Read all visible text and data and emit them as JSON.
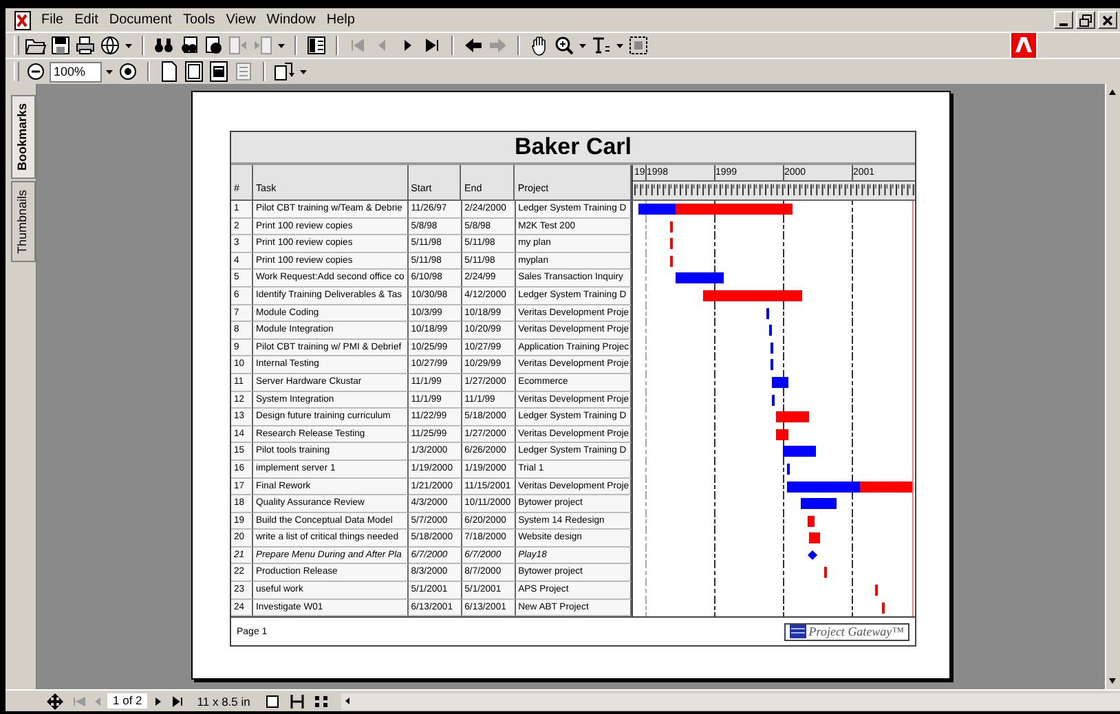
{
  "menu": [
    "File",
    "Edit",
    "Document",
    "Tools",
    "View",
    "Window",
    "Help"
  ],
  "toolbar": {
    "zoom_value": "100%"
  },
  "side_tabs": [
    {
      "label": "Bookmarks",
      "selected": true
    },
    {
      "label": "Thumbnails",
      "selected": false
    }
  ],
  "report": {
    "title": "Baker Carl",
    "columns": [
      "#",
      "Task",
      "Start",
      "End",
      "Project"
    ],
    "years": [
      "19",
      "1998",
      "1999",
      "2000",
      "2001"
    ],
    "tasks": [
      {
        "num": "1",
        "task": "Pilot CBT training w/Team & Debrie",
        "start": "11/26/97",
        "end": "2/24/2000",
        "project": "Ledger System Training D",
        "kind": "split",
        "level": 0.24
      },
      {
        "num": "2",
        "task": "Print 100 review copies",
        "start": "5/8/98",
        "end": "5/8/98",
        "project": "M2K Test 200",
        "kind": "bar",
        "color": "#ff0000"
      },
      {
        "num": "3",
        "task": "Print 100 review copies",
        "start": "5/11/98",
        "end": "5/11/98",
        "project": "my plan",
        "kind": "bar",
        "color": "#ff0000"
      },
      {
        "num": "4",
        "task": "Print 100 review copies",
        "start": "5/11/98",
        "end": "5/11/98",
        "project": "myplan",
        "kind": "bar",
        "color": "#ff0000"
      },
      {
        "num": "5",
        "task": "Work Request:Add second office co",
        "start": "6/10/98",
        "end": "2/24/99",
        "project": "Sales Transaction Inquiry",
        "kind": "bar",
        "color": "#0000ff"
      },
      {
        "num": "6",
        "task": "Identify Training Deliverables & Tas",
        "start": "10/30/98",
        "end": "4/12/2000",
        "project": "Ledger System Training D",
        "kind": "bar",
        "color": "#ff0000"
      },
      {
        "num": "7",
        "task": "Module Coding",
        "start": "10/3/99",
        "end": "10/18/99",
        "project": "Veritas Development Proje",
        "kind": "bar",
        "color": "#0000ff"
      },
      {
        "num": "8",
        "task": "Module Integration",
        "start": "10/18/99",
        "end": "10/20/99",
        "project": "Veritas Development Proje",
        "kind": "bar",
        "color": "#0000ff"
      },
      {
        "num": "9",
        "task": "Pilot CBT training w/ PMI & Debrief",
        "start": "10/25/99",
        "end": "10/27/99",
        "project": "Application Training Projec",
        "kind": "bar",
        "color": "#0000ff"
      },
      {
        "num": "10",
        "task": "Internal Testing",
        "start": "10/27/99",
        "end": "10/29/99",
        "project": "Veritas Development Proje",
        "kind": "bar",
        "color": "#0000ff"
      },
      {
        "num": "11",
        "task": "Server Hardware Ckustar",
        "start": "11/1/99",
        "end": "1/27/2000",
        "project": "Ecommerce",
        "kind": "bar",
        "color": "#0000ff"
      },
      {
        "num": "12",
        "task": "System Integration",
        "start": "11/1/99",
        "end": "11/1/99",
        "project": "Veritas Development Proje",
        "kind": "bar",
        "color": "#0000ff"
      },
      {
        "num": "13",
        "task": "Design future training curriculum",
        "start": "11/22/99",
        "end": "5/18/2000",
        "project": "Ledger System Training D",
        "kind": "bar",
        "color": "#ff0000"
      },
      {
        "num": "14",
        "task": "Research Release Testing",
        "start": "11/25/99",
        "end": "1/27/2000",
        "project": "Veritas Development Proje",
        "kind": "bar",
        "color": "#ff0000"
      },
      {
        "num": "15",
        "task": "Pilot tools training",
        "start": "1/3/2000",
        "end": "6/26/2000",
        "project": "Ledger System Training D",
        "kind": "bar",
        "color": "#0000ff"
      },
      {
        "num": "16",
        "task": "implement server 1",
        "start": "1/19/2000",
        "end": "1/19/2000",
        "project": "Trial 1",
        "kind": "bar",
        "color": "#0000ff"
      },
      {
        "num": "17",
        "task": "Final Rework",
        "start": "1/21/2000",
        "end": "11/15/2001",
        "project": "Veritas Development Proje",
        "kind": "split",
        "level": 0.59
      },
      {
        "num": "18",
        "task": "Quality Assurance Review",
        "start": "4/3/2000",
        "end": "10/11/2000",
        "project": "Bytower project",
        "kind": "bar",
        "color": "#0000ff"
      },
      {
        "num": "19",
        "task": "Build the Conceptual Data Model",
        "start": "5/7/2000",
        "end": "6/20/2000",
        "project": "System 14 Redesign",
        "kind": "bar",
        "color": "#ff0000"
      },
      {
        "num": "20",
        "task": "write a list of critical things needed",
        "start": "5/18/2000",
        "end": "7/18/2000",
        "project": "Website design",
        "kind": "bar",
        "color": "#ff0000"
      },
      {
        "num": "21",
        "task": "Prepare Menu During and After Pla",
        "start": "6/7/2000",
        "end": "6/7/2000",
        "project": "Play18",
        "kind": "milestone",
        "color": "#0000ff"
      },
      {
        "num": "22",
        "task": "Production Release",
        "start": "8/3/2000",
        "end": "8/7/2000",
        "project": "Bytower project",
        "kind": "bar",
        "color": "#ff0000"
      },
      {
        "num": "23",
        "task": "useful work",
        "start": "5/1/2001",
        "end": "5/1/2001",
        "project": "APS Project",
        "kind": "bar",
        "color": "#ff0000"
      },
      {
        "num": "24",
        "task": "Investigate W01",
        "start": "6/13/2001",
        "end": "6/13/2001",
        "project": "New ABT Project",
        "kind": "bar",
        "color": "#ff0000"
      }
    ],
    "footer": "Page 1",
    "brand": "Project Gateway™"
  },
  "status_bar": {
    "page_field": "1 of 2",
    "page_size": "11 x 8.5 in"
  }
}
